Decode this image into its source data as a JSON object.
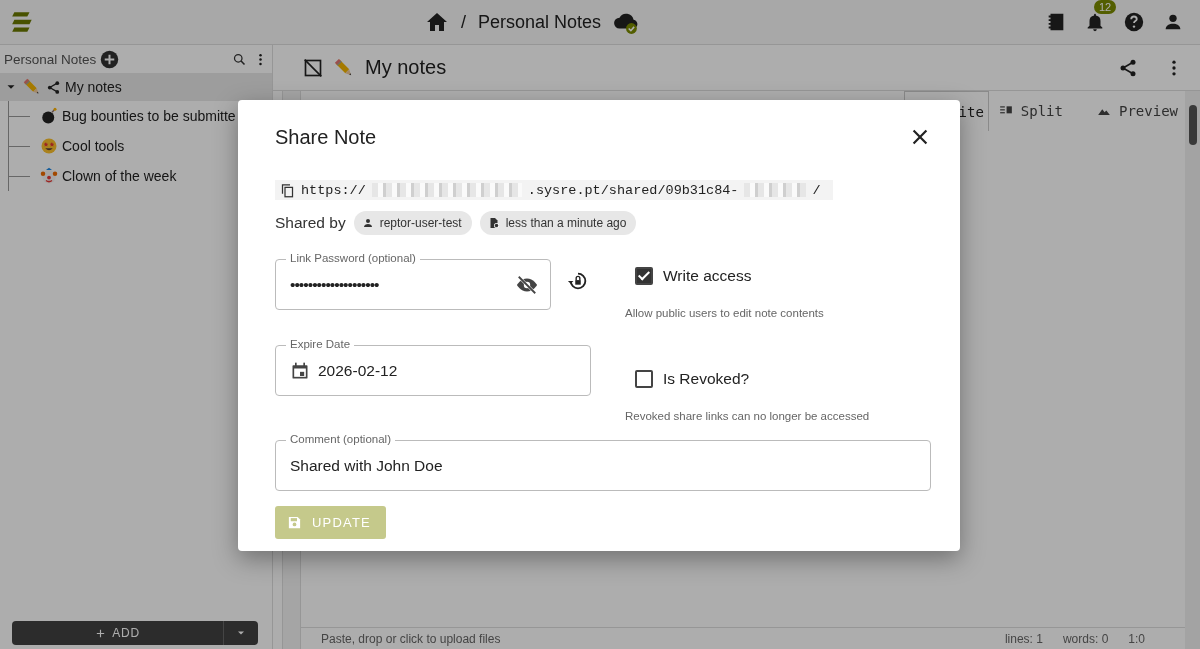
{
  "app_bar": {
    "breadcrumb_separator": "/",
    "breadcrumb": "Personal Notes",
    "notification_count": "12"
  },
  "sidebar": {
    "title": "Personal Notes",
    "tree": [
      {
        "label": "My notes",
        "shared": true,
        "expanded": true,
        "selected": true,
        "children": [
          {
            "label": "Bug bounties to be submitte",
            "selected": false
          },
          {
            "label": "Cool tools",
            "selected": false
          },
          {
            "label": "Clown of the week",
            "selected": false
          }
        ]
      }
    ],
    "add_button": "ADD"
  },
  "editor": {
    "title": "My notes",
    "tabs": [
      {
        "label": "ite",
        "selected": true
      },
      {
        "label": "Split",
        "selected": false
      },
      {
        "label": "Preview",
        "selected": false
      }
    ],
    "status": {
      "hint": "Paste, drop or click to upload files",
      "lines": "lines: 1",
      "words": "words: 0",
      "position": "1:0"
    }
  },
  "dialog": {
    "title": "Share Note",
    "url": [
      {
        "kind": "text",
        "text": "https://"
      },
      {
        "kind": "redacted"
      },
      {
        "kind": "text",
        "text": ".sysre.pt/shared/09b31c84-"
      },
      {
        "kind": "redacted"
      },
      {
        "kind": "text",
        "text": "/"
      }
    ],
    "shared_by_label": "Shared by",
    "chips": [
      {
        "kind": "user",
        "label": "reptor-user-test"
      },
      {
        "kind": "time",
        "label": "less than a minute ago"
      }
    ],
    "password": {
      "label": "Link Password (optional)",
      "value": "••••••••••••••••••••"
    },
    "write_access": {
      "label": "Write access",
      "checked": true,
      "hint": "Allow public users to edit note contents"
    },
    "expire": {
      "label": "Expire Date",
      "value": "2026-02-12"
    },
    "revoked": {
      "label": "Is Revoked?",
      "checked": false,
      "hint": "Revoked share links can no longer be accessed"
    },
    "comment": {
      "label": "Comment (optional)",
      "value": "Shared with John Doe"
    },
    "update_button": "UPDATE"
  }
}
